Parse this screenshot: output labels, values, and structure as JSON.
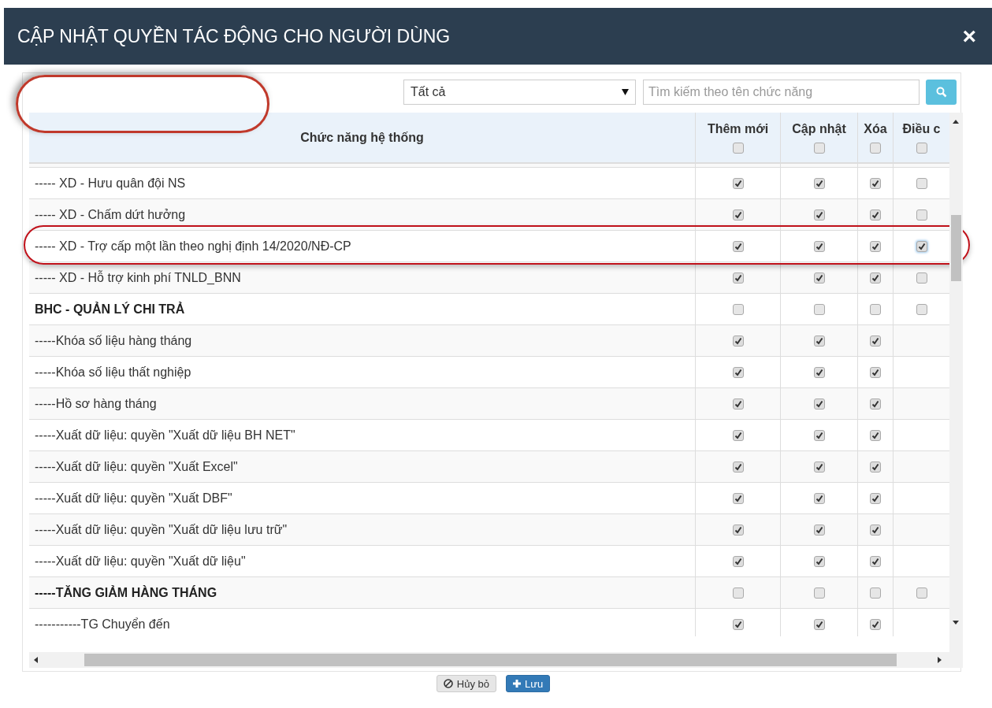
{
  "dialog": {
    "title": "CẬP NHẬT QUYỀN TÁC ĐỘNG CHO NGƯỜI DÙNG",
    "close": "×"
  },
  "toolbar": {
    "circled": true,
    "filter": "Tất cả",
    "search_placeholder": "Tìm kiếm theo tên chức năng"
  },
  "table": {
    "columns": [
      {
        "label": "Chức năng hệ thống"
      },
      {
        "label": "Thêm mới",
        "checked": false
      },
      {
        "label": "Cập nhật",
        "checked": false
      },
      {
        "label": "Xóa",
        "checked": false
      },
      {
        "label": "Điều c",
        "checked": false
      }
    ],
    "rows": [
      {
        "kind": "item",
        "label": "----- XD - Hưu quân đội NS",
        "circled": false,
        "checks": [
          true,
          true,
          true,
          false
        ]
      },
      {
        "kind": "item",
        "label": "----- XD - Chấm dứt hưởng",
        "circled": false,
        "checks": [
          true,
          true,
          true,
          false
        ]
      },
      {
        "kind": "item",
        "label": "----- XD - Trợ cấp một lần theo nghị định 14/2020/NĐ-CP",
        "circled": true,
        "checks": [
          true,
          true,
          true,
          true
        ]
      },
      {
        "kind": "item",
        "label": "----- XD - Hỗ trợ kinh phí TNLD_BNN",
        "circled": false,
        "checks": [
          true,
          true,
          true,
          false
        ]
      },
      {
        "kind": "group",
        "label": "BHC - QUẢN LÝ CHI TRẢ",
        "circled": false,
        "checks": [
          false,
          false,
          false,
          false
        ]
      },
      {
        "kind": "item",
        "label": "-----Khóa số liệu hàng tháng",
        "circled": false,
        "checks": [
          true,
          true,
          true
        ]
      },
      {
        "kind": "item",
        "label": "-----Khóa số liệu thất nghiệp",
        "circled": false,
        "checks": [
          true,
          true,
          true
        ]
      },
      {
        "kind": "item",
        "label": "-----Hồ sơ hàng tháng",
        "circled": false,
        "checks": [
          true,
          true,
          true
        ]
      },
      {
        "kind": "item",
        "label": "-----Xuất dữ liệu: quyền \"Xuất dữ liệu BH NET\"",
        "circled": false,
        "checks": [
          true,
          true,
          true
        ]
      },
      {
        "kind": "item",
        "label": "-----Xuất dữ liệu: quyền \"Xuất Excel\"",
        "circled": false,
        "checks": [
          true,
          true,
          true
        ]
      },
      {
        "kind": "item",
        "label": "-----Xuất dữ liệu: quyền \"Xuất DBF\"",
        "circled": false,
        "checks": [
          true,
          true,
          true
        ]
      },
      {
        "kind": "item",
        "label": "-----Xuất dữ liệu: quyền \"Xuất dữ liệu lưu trữ\"",
        "circled": false,
        "checks": [
          true,
          true,
          true
        ]
      },
      {
        "kind": "item",
        "label": "-----Xuất dữ liệu: quyền \"Xuất dữ liệu\"",
        "circled": false,
        "checks": [
          true,
          true,
          true
        ]
      },
      {
        "kind": "group",
        "label": "-----TĂNG GIẢM HÀNG THÁNG",
        "circled": false,
        "checks": [
          false,
          false,
          false,
          false
        ]
      },
      {
        "kind": "item",
        "label": "-----------TG Chuyển đến",
        "circled": false,
        "checks": [
          true,
          true,
          true
        ]
      }
    ]
  },
  "buttons": [
    {
      "kind": "cancel",
      "label": "Hủy bỏ"
    },
    {
      "kind": "save",
      "label": "Lưu"
    }
  ]
}
